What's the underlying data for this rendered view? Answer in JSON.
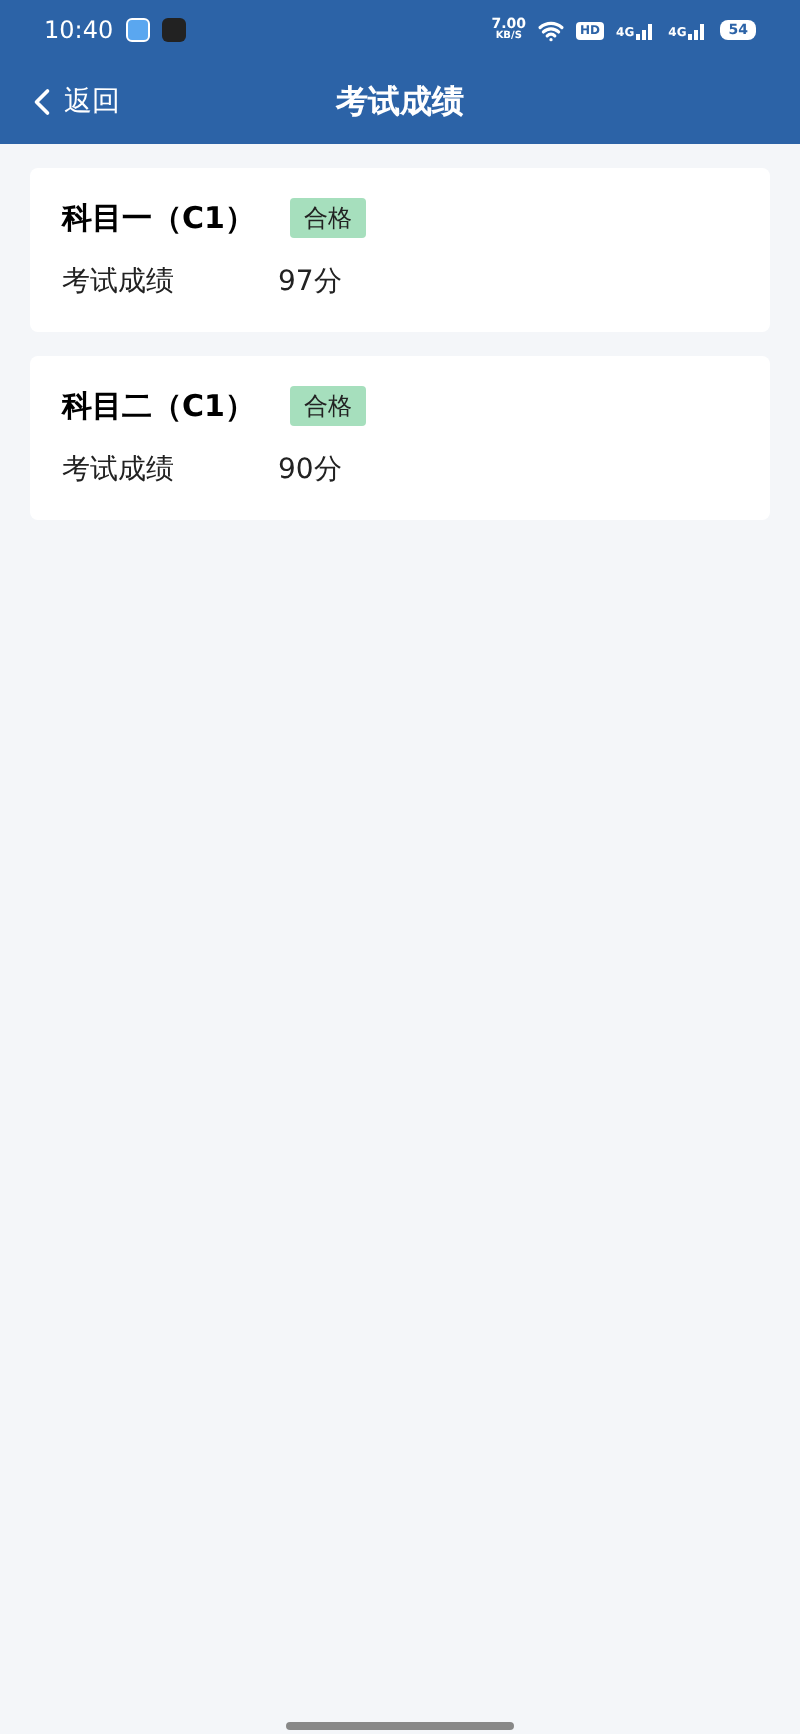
{
  "status_bar": {
    "time": "10:40",
    "speed": "7.00",
    "speed_unit": "KB/S",
    "hd": "HD",
    "network_1": "4G",
    "network_2": "4G",
    "battery": "54"
  },
  "header": {
    "back": "返回",
    "title": "考试成绩"
  },
  "results": [
    {
      "subject": "科目一（C1）",
      "badge": "合格",
      "label": "考试成绩",
      "score": "97分"
    },
    {
      "subject": "科目二（C1）",
      "badge": "合格",
      "label": "考试成绩",
      "score": "90分"
    }
  ]
}
